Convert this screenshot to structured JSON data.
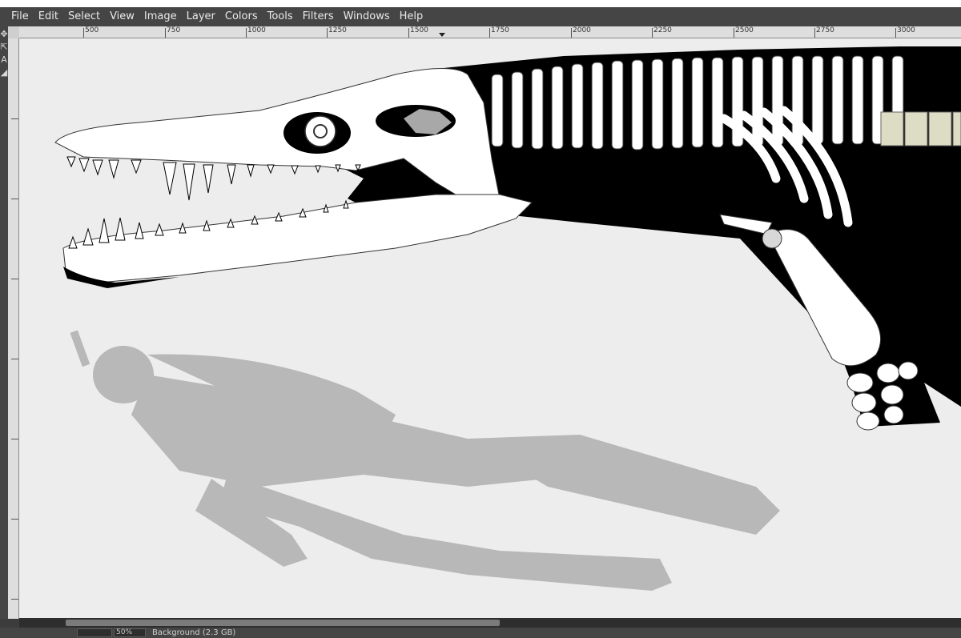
{
  "menu": {
    "items": [
      "File",
      "Edit",
      "Select",
      "View",
      "Image",
      "Layer",
      "Colors",
      "Tools",
      "Filters",
      "Windows",
      "Help"
    ]
  },
  "toolstrip": {
    "icons": [
      "move-tool-icon",
      "align-tool-icon",
      "text-tool-icon",
      "paint-tool-icon"
    ],
    "glyphs": [
      "✥",
      "⇱",
      "A",
      "◢"
    ]
  },
  "ruler": {
    "h_labels": [
      "500",
      "750",
      "1000",
      "1250",
      "1500",
      "1750",
      "2000",
      "2250",
      "2500",
      "2750",
      "3000"
    ]
  },
  "canvas": {
    "background": "#ededed",
    "body_color": "#000000",
    "bone_color": "#ffffff",
    "diver_color": "#b8b8b8",
    "vertebra_tint": "#dddcc4"
  },
  "status": {
    "zoom": "50%",
    "layer_info": "Background (2.3 GB)"
  }
}
